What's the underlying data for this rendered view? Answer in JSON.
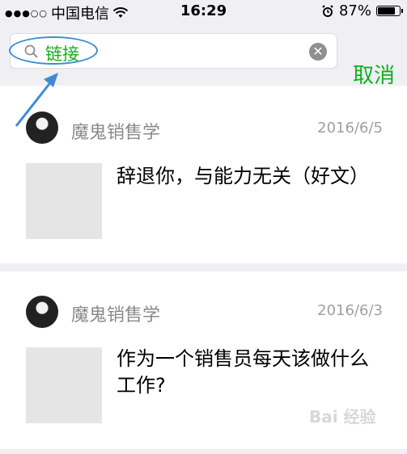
{
  "status_bar": {
    "carrier": "中国电信",
    "time": "16:29",
    "battery": "87%",
    "battery_level": 0.87
  },
  "search": {
    "query": "链接",
    "cancel_label": "取消"
  },
  "results": [
    {
      "author": "魔鬼销售学",
      "date": "2016/6/5",
      "title": "辞退你，与能力无关（好文）"
    },
    {
      "author": "魔鬼销售学",
      "date": "2016/6/3",
      "title": "作为一个销售员每天该做什么工作?"
    }
  ],
  "watermark": "Bai 经验"
}
